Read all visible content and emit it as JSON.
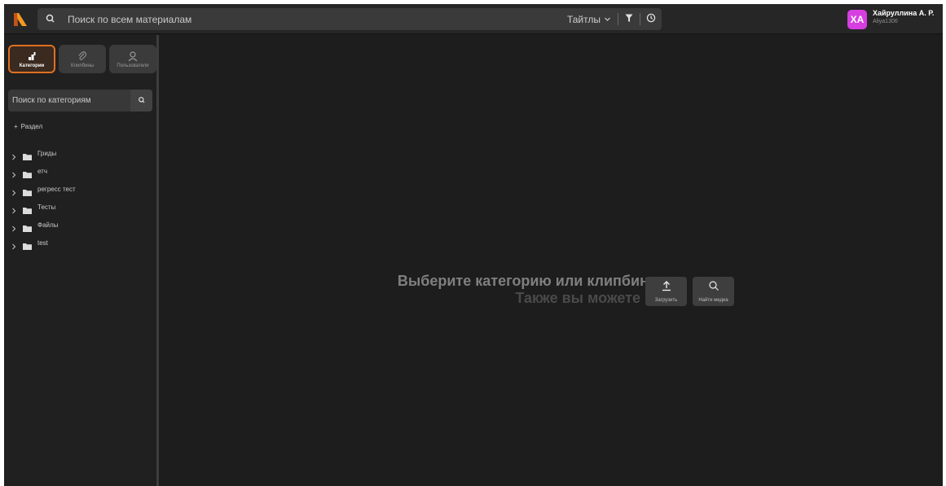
{
  "header": {
    "search_placeholder": "Поиск по всем материалам",
    "scope_label": "Тайтлы",
    "user": {
      "initials": "ХА",
      "name": "Хайруллина А. Р.",
      "login": "Aliya1306",
      "avatar_color": "#d63ee0"
    }
  },
  "sidebar": {
    "tabs": [
      {
        "label": "Категории",
        "icon": "categories-icon",
        "active": true
      },
      {
        "label": "Клипбины",
        "icon": "paperclip-icon",
        "active": false
      },
      {
        "label": "Пользователи",
        "icon": "user-icon",
        "active": false
      }
    ],
    "search_placeholder": "Поиск по категориям",
    "add_section_label": "Раздел",
    "tree": [
      {
        "label": "Гриды"
      },
      {
        "label": "етч"
      },
      {
        "label": "регресс тест"
      },
      {
        "label": "Тесты"
      },
      {
        "label": "Файлы"
      },
      {
        "label": "test"
      }
    ]
  },
  "main": {
    "empty_title": "Выберите категорию или клипбин",
    "empty_subtitle": "Также вы можете",
    "actions": [
      {
        "label": "Загрузить",
        "icon": "upload-icon"
      },
      {
        "label": "Найти медиа",
        "icon": "search-icon"
      }
    ]
  },
  "colors": {
    "accent": "#e0701f",
    "background": "#1d1d1d",
    "topbar": "#262626"
  }
}
